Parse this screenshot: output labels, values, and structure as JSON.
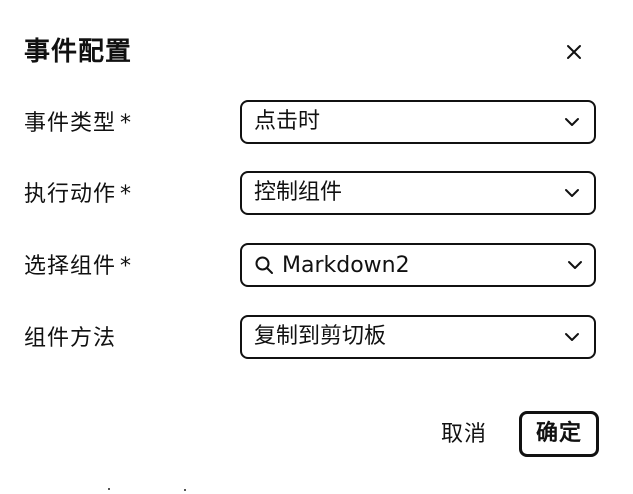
{
  "dialog": {
    "title": "事件配置",
    "close_icon": "close-icon"
  },
  "form": {
    "rows": [
      {
        "label": "事件类型",
        "required_mark": "*",
        "value": "点击时"
      },
      {
        "label": "执行动作",
        "required_mark": "*",
        "value": "控制组件"
      },
      {
        "label": "选择组件",
        "required_mark": "*",
        "value": "Markdown2",
        "icon": "search-icon"
      },
      {
        "label": "组件方法",
        "required_mark": "",
        "value": "复制到剪切板"
      }
    ]
  },
  "footer": {
    "cancel_label": "取消",
    "ok_label": "确定"
  },
  "colors": {
    "text": "#111111",
    "border": "#111111",
    "background": "#ffffff"
  }
}
